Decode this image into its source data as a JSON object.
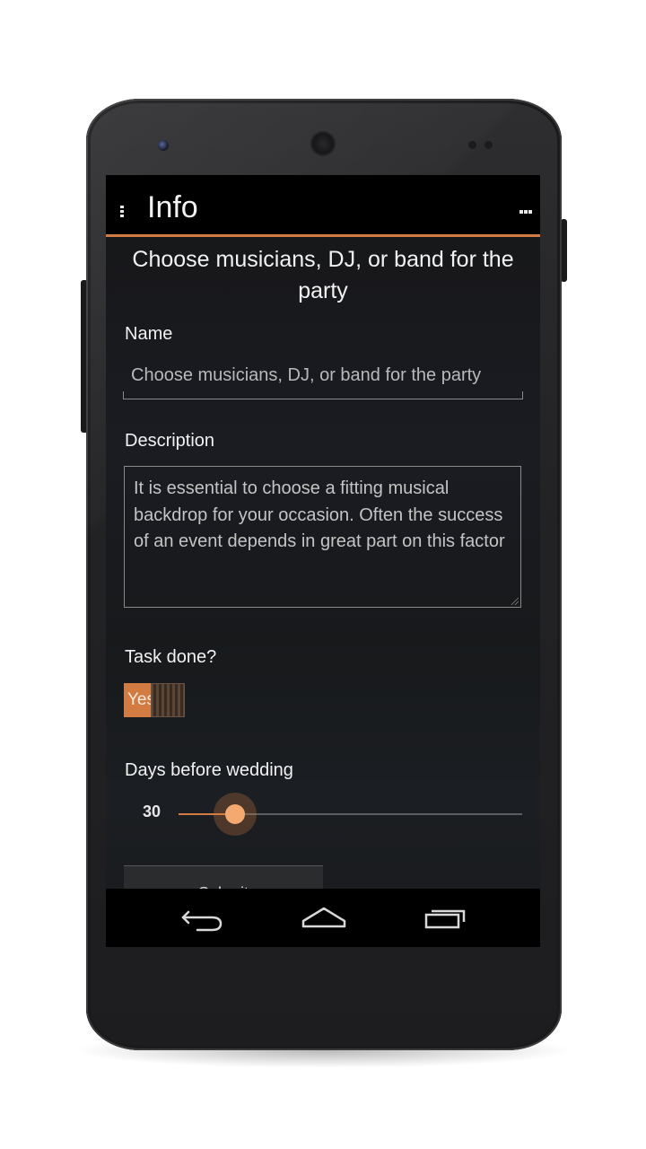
{
  "action_bar": {
    "title": "Info"
  },
  "task": {
    "heading": "Choose musicians, DJ, or band for the party"
  },
  "form": {
    "name_label": "Name",
    "name_value": "Choose musicians, DJ, or band for the party",
    "description_label": "Description",
    "description_value": "It is essential to choose a fitting musical backdrop for your occasion. Often the success of an event depends in great part on this factor",
    "task_done_label": "Task done?",
    "task_done_toggle_text": "Yes",
    "days_label": "Days before wedding",
    "days_value": "30",
    "days_fraction": 0.16,
    "submit_label": "Submit"
  },
  "colors": {
    "accent": "#d27c43",
    "background": "#1a1c22",
    "action_bar": "#000000"
  },
  "icons": {
    "action_overflow_left": "overflow-vertical-icon",
    "action_overflow_right": "overflow-horizontal-icon",
    "nav_back": "back-icon",
    "nav_home": "home-icon",
    "nav_recent": "recent-apps-icon"
  }
}
